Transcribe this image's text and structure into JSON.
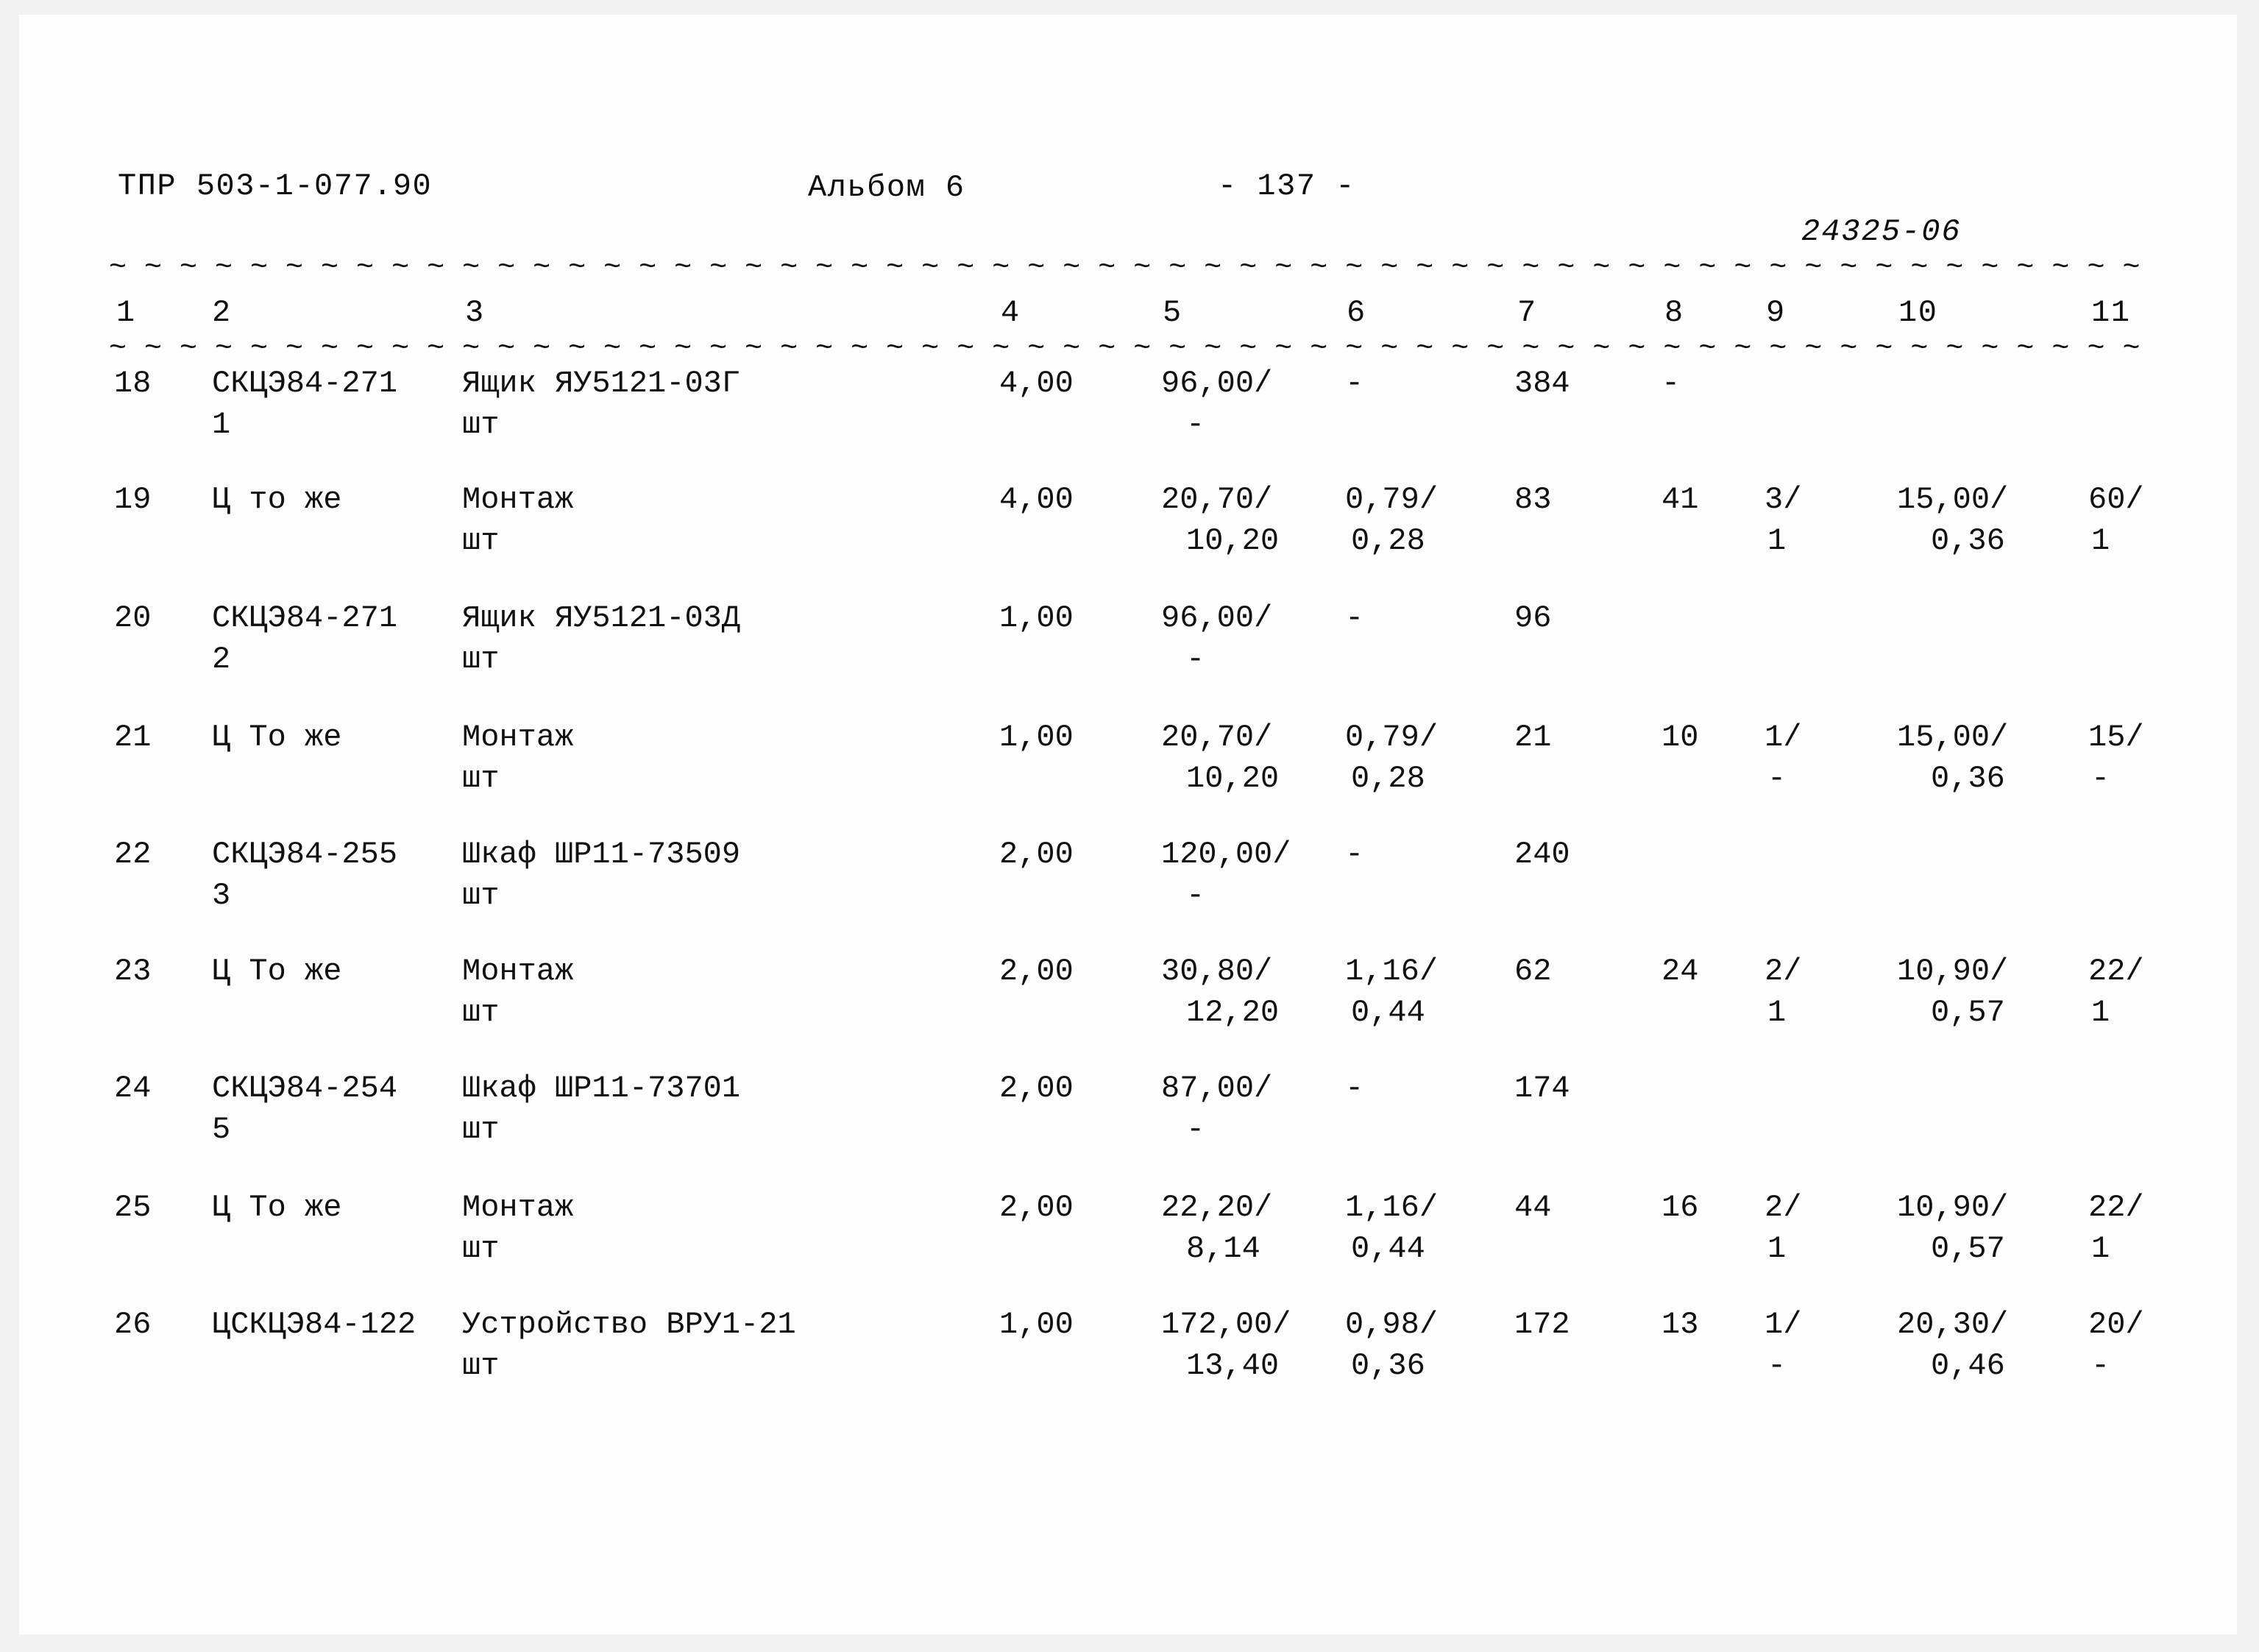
{
  "document": {
    "doc_code": "ТПР 503-1-077.90",
    "album_label": "Альбом 6",
    "page_number": "- 137 -",
    "sheet_code": "24325-06",
    "dash_rule": "~ ~ ~ ~ ~ ~ ~ ~ ~ ~ ~ ~ ~ ~ ~ ~ ~ ~ ~ ~ ~ ~ ~ ~ ~ ~ ~ ~ ~ ~ ~ ~ ~ ~ ~ ~ ~ ~ ~ ~ ~ ~ ~ ~ ~ ~ ~ ~ ~ ~ ~ ~ ~ ~ ~ ~ ~ ~"
  },
  "table": {
    "column_headers": [
      "1",
      "2",
      "3",
      "4",
      "5",
      "6",
      "7",
      "8",
      "9",
      "10",
      "11"
    ],
    "rows": [
      {
        "c1": "18",
        "c2_line1": "СКЦЭ84-271",
        "c2_line2": "1",
        "c3_line1": "Ящик ЯУ5121-03Г",
        "c3_line2": "шт",
        "c4_line1": "4,00",
        "c4_line2": "",
        "c5_line1": "96,00/",
        "c5_line2": "-",
        "c6_line1": "-",
        "c6_line2": "",
        "c7_line1": "384",
        "c7_line2": "",
        "c8_line1": "-",
        "c8_line2": "",
        "c9_line1": "",
        "c9_line2": "",
        "c10_line1": "",
        "c10_line2": "",
        "c11_line1": "",
        "c11_line2": ""
      },
      {
        "c1": "19",
        "c2_line1": "Ц то же",
        "c2_line2": "",
        "c3_line1": "Монтаж",
        "c3_line2": "шт",
        "c4_line1": "4,00",
        "c4_line2": "",
        "c5_line1": "20,70/",
        "c5_line2": "10,20",
        "c6_line1": "0,79/",
        "c6_line2": "0,28",
        "c7_line1": "83",
        "c7_line2": "",
        "c8_line1": "41",
        "c8_line2": "",
        "c9_line1": "3/",
        "c9_line2": "1",
        "c10_line1": "15,00/",
        "c10_line2": "0,36",
        "c11_line1": "60/",
        "c11_line2": "1"
      },
      {
        "c1": "20",
        "c2_line1": "СКЦЭ84-271",
        "c2_line2": "2",
        "c3_line1": "Ящик ЯУ5121-03Д",
        "c3_line2": "шт",
        "c4_line1": "1,00",
        "c4_line2": "",
        "c5_line1": "96,00/",
        "c5_line2": "-",
        "c6_line1": "-",
        "c6_line2": "",
        "c7_line1": "96",
        "c7_line2": "",
        "c8_line1": "",
        "c8_line2": "",
        "c9_line1": "",
        "c9_line2": "",
        "c10_line1": "",
        "c10_line2": "",
        "c11_line1": "",
        "c11_line2": ""
      },
      {
        "c1": "21",
        "c2_line1": "Ц То же",
        "c2_line2": "",
        "c3_line1": "Монтаж",
        "c3_line2": "шт",
        "c4_line1": "1,00",
        "c4_line2": "",
        "c5_line1": "20,70/",
        "c5_line2": "10,20",
        "c6_line1": "0,79/",
        "c6_line2": "0,28",
        "c7_line1": "21",
        "c7_line2": "",
        "c8_line1": "10",
        "c8_line2": "",
        "c9_line1": "1/",
        "c9_line2": "-",
        "c10_line1": "15,00/",
        "c10_line2": "0,36",
        "c11_line1": "15/",
        "c11_line2": "-"
      },
      {
        "c1": "22",
        "c2_line1": "СКЦЭ84-255",
        "c2_line2": "3",
        "c3_line1": "Шкаф ШР11-73509",
        "c3_line2": "шт",
        "c4_line1": "2,00",
        "c4_line2": "",
        "c5_line1": "120,00/",
        "c5_line2": "-",
        "c6_line1": "-",
        "c6_line2": "",
        "c7_line1": "240",
        "c7_line2": "",
        "c8_line1": "",
        "c8_line2": "",
        "c9_line1": "",
        "c9_line2": "",
        "c10_line1": "",
        "c10_line2": "",
        "c11_line1": "",
        "c11_line2": ""
      },
      {
        "c1": "23",
        "c2_line1": "Ц То же",
        "c2_line2": "",
        "c3_line1": "Монтаж",
        "c3_line2": "шт",
        "c4_line1": "2,00",
        "c4_line2": "",
        "c5_line1": "30,80/",
        "c5_line2": "12,20",
        "c6_line1": "1,16/",
        "c6_line2": "0,44",
        "c7_line1": "62",
        "c7_line2": "",
        "c8_line1": "24",
        "c8_line2": "",
        "c9_line1": "2/",
        "c9_line2": "1",
        "c10_line1": "10,90/",
        "c10_line2": "0,57",
        "c11_line1": "22/",
        "c11_line2": "1"
      },
      {
        "c1": "24",
        "c2_line1": "СКЦЭ84-254",
        "c2_line2": "5",
        "c3_line1": "Шкаф ШР11-73701",
        "c3_line2": "шт",
        "c4_line1": "2,00",
        "c4_line2": "",
        "c5_line1": "87,00/",
        "c5_line2": "-",
        "c6_line1": "-",
        "c6_line2": "",
        "c7_line1": "174",
        "c7_line2": "",
        "c8_line1": "",
        "c8_line2": "",
        "c9_line1": "",
        "c9_line2": "",
        "c10_line1": "",
        "c10_line2": "",
        "c11_line1": "",
        "c11_line2": ""
      },
      {
        "c1": "25",
        "c2_line1": "Ц То же",
        "c2_line2": "",
        "c3_line1": "Монтаж",
        "c3_line2": "шт",
        "c4_line1": "2,00",
        "c4_line2": "",
        "c5_line1": "22,20/",
        "c5_line2": "8,14",
        "c6_line1": "1,16/",
        "c6_line2": "0,44",
        "c7_line1": "44",
        "c7_line2": "",
        "c8_line1": "16",
        "c8_line2": "",
        "c9_line1": "2/",
        "c9_line2": "1",
        "c10_line1": "10,90/",
        "c10_line2": "0,57",
        "c11_line1": "22/",
        "c11_line2": "1"
      },
      {
        "c1": "26",
        "c2_line1": "ЦСКЦЭ84-122",
        "c2_line2": "",
        "c3_line1": "Устройство ВРУ1-21",
        "c3_line2": "шт",
        "c4_line1": "1,00",
        "c4_line2": "",
        "c5_line1": "172,00/",
        "c5_line2": "13,40",
        "c6_line1": "0,98/",
        "c6_line2": "0,36",
        "c7_line1": "172",
        "c7_line2": "",
        "c8_line1": "13",
        "c8_line2": "",
        "c9_line1": "1/",
        "c9_line2": "-",
        "c10_line1": "20,30/",
        "c10_line2": "0,46",
        "c11_line1": "20/",
        "c11_line2": "-"
      }
    ]
  }
}
